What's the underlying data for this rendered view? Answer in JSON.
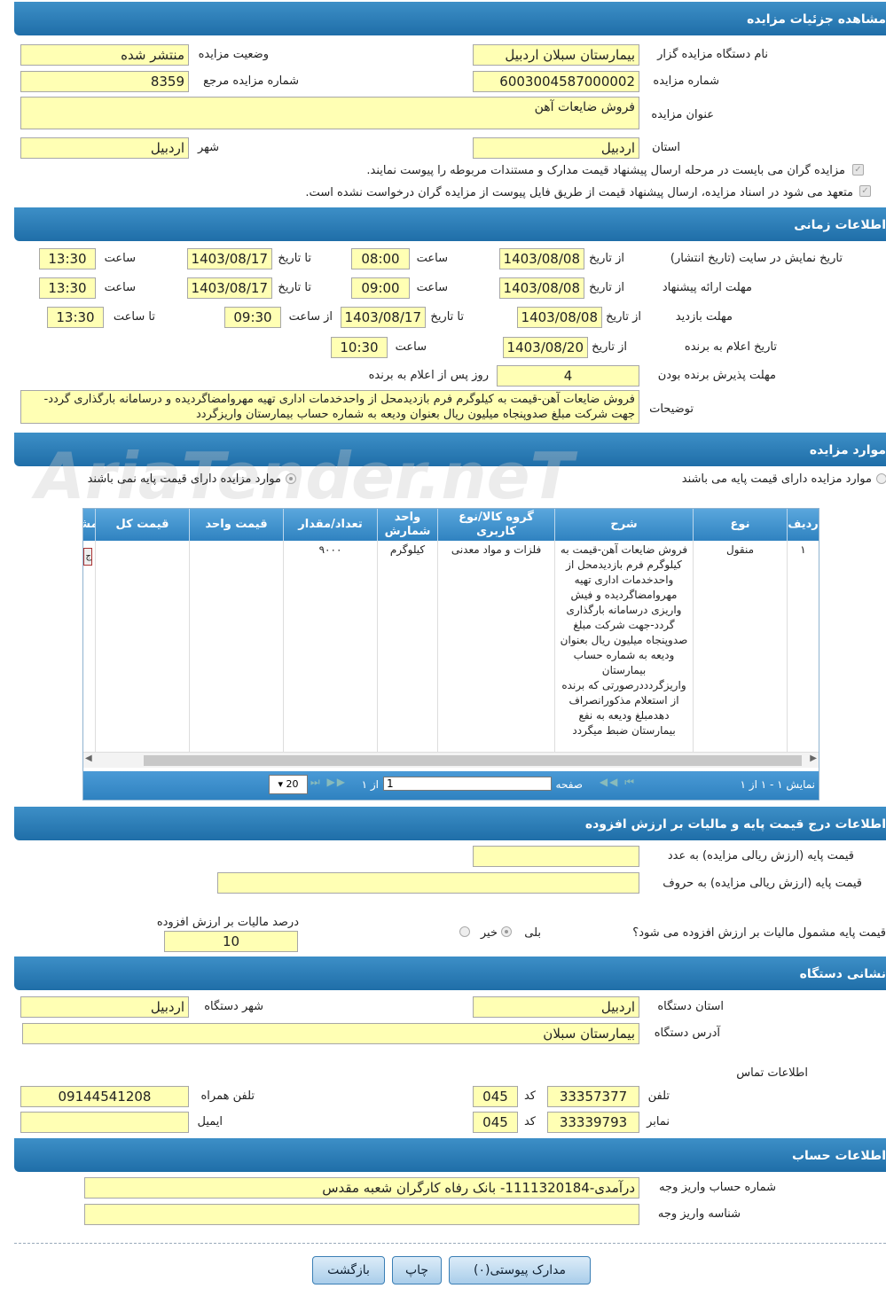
{
  "details": {
    "title": "مشاهده جزئیات مزایده",
    "org_label": "نام دستگاه مزایده گزار",
    "org": "بیمارستان سبلان اردبیل",
    "status_label": "وضعیت مزایده",
    "status": "منتشر شده",
    "num_label": "شماره مزایده",
    "num": "6003004587000002",
    "ref_label": "شماره مزایده مرجع",
    "ref": "8359",
    "subject_label": "عنوان مزایده",
    "subject": "فروش ضایعات آهن",
    "province_label": "استان",
    "province": "اردبیل",
    "city_label": "شهر",
    "city": "اردبیل",
    "check1": "مزایده گران می بایست در مرحله ارسال پیشنهاد قیمت مدارک و مستندات مربوطه را پیوست نمایند.",
    "check2": "متعهد می شود در اسناد مزایده، ارسال پیشنهاد قیمت از طریق فایل پیوست از مزایده گران درخواست نشده است."
  },
  "timing": {
    "title": "اطلاعات زمانی",
    "r1_label": "تاریخ نمایش در سایت (تاریخ انتشار)",
    "from": "از تاریخ",
    "time": "ساعت",
    "to": "تا تاریخ",
    "r1_from": "1403/08/08",
    "r1_time1": "08:00",
    "r1_to": "1403/08/17",
    "r1_time2": "13:30",
    "r2_label": "مهلت ارائه پیشنهاد",
    "r2_from": "1403/08/08",
    "r2_time1": "09:00",
    "r2_to": "1403/08/17",
    "r2_time2": "13:30",
    "r3_label": "مهلت بازدید",
    "r3_from": "1403/08/08",
    "r3_to": "1403/08/17",
    "from_time": "از ساعت",
    "to_time": "تا ساعت",
    "r3_time1": "09:30",
    "r3_time2": "13:30",
    "r4_label": "تاریخ اعلام به برنده",
    "r4_from": "1403/08/20",
    "r4_time": "10:30",
    "r5_label": "مهلت پذیرش برنده بودن",
    "r5_val": "4",
    "r5_suffix": "روز پس از اعلام به برنده",
    "desc_label": "توضیحات",
    "desc": "فروش ضایعات آهن-قیمت به کیلوگرم فرم بازدیدمحل از واحدخدمات اداری تهیه مهروامضاگردیده و درسامانه بارگذاری گردد-جهت شرکت مبلغ صدوپنجاه میلیون ریال بعنوان ودیعه به شماره حساب بیمارستان واریزگردد"
  },
  "items": {
    "title": "موارد مزایده",
    "opt1": "موارد مزایده دارای قیمت پایه می باشند",
    "opt2": "موارد مزایده دارای قیمت پایه نمی باشند",
    "cols": [
      "ردیف",
      "نوع",
      "شرح",
      "گروه کالا/نوع کاربری",
      "واحد شمارش",
      "تعداد/مقدار",
      "قیمت واحد",
      "قیمت کل",
      "مشا"
    ],
    "row": {
      "idx": "۱",
      "type": "منقول",
      "desc": "فروش ضایعات آهن-قیمت به کیلوگرم فرم بازدیدمحل از واحدخدمات اداری تهیه مهروامضاگردیده و فیش واریزی درسامانه بارگذاری گردد-جهت شرکت مبلغ صدوپنجاه میلیون ریال بعنوان ودیعه به شماره حساب بیمارستان واریزگردددرصورتی که برنده از استعلام مذکورانصراف دهدمبلغ ودیعه به نفع بیمارستان ضبط میگردد",
      "group": "فلزات و مواد معدنی",
      "unit": "کیلوگرم",
      "qty": "۹۰۰۰",
      "cell_btn": "ج"
    },
    "pager": {
      "showing": "نمایش ۱ - ۱ از ۱",
      "page": "صفحه",
      "page_val": "1",
      "of": "از ۱",
      "size": "20"
    }
  },
  "price": {
    "title": "اطلاعات درج قیمت پایه و مالیات بر ارزش افزوده",
    "num_label": "قیمت پایه (ارزش ریالی مزایده) به عدد",
    "words_label": "قیمت پایه (ارزش ریالی مزایده) به حروف",
    "vat_q": "قیمت پایه مشمول مالیات بر ارزش افزوده می شود؟",
    "yes": "بلی",
    "no": "خیر",
    "vat_label": "درصد مالیات بر ارزش افزوده",
    "vat": "10"
  },
  "addr": {
    "title": "نشانی دستگاه",
    "prov_label": "استان دستگاه",
    "prov": "اردبیل",
    "city_label": "شهر دستگاه",
    "city": "اردبیل",
    "addr_label": "آدرس دستگاه",
    "addr": "بیمارستان سبلان",
    "contact": "اطلاعات تماس",
    "tel_label": "تلفن",
    "tel": "33357377",
    "code": "کد",
    "tel_code": "045",
    "mob_label": "تلفن همراه",
    "mob": "09144541208",
    "fax_label": "نمابر",
    "fax": "33339793",
    "fax_code": "045",
    "email_label": "ایمیل"
  },
  "account": {
    "title": "اطلاعات حساب",
    "acc_label": "شماره حساب واریز وجه",
    "acc": "درآمدی-1111320184- بانک رفاه کارگران شعبه مقدس",
    "id_label": "شناسه واریز وجه"
  },
  "buttons": {
    "docs": "مدارک پیوستی(۰)",
    "print": "چاپ",
    "back": "بازگشت"
  },
  "watermark": "AriaTender.neT"
}
